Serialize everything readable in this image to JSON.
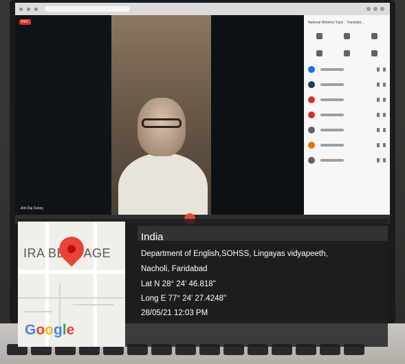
{
  "meet": {
    "rec_badge": "REC",
    "panel_title": "National Webinar Topic - Translatio...",
    "speaker_name": "Anil Raj Dubey",
    "participants": [
      {
        "avatar_color": "#1a73e8"
      },
      {
        "avatar_color": "#1f3b5c"
      },
      {
        "avatar_color": "#d93025"
      },
      {
        "avatar_color": "#d93025"
      },
      {
        "avatar_color": "#5f6368"
      },
      {
        "avatar_color": "#e37400"
      },
      {
        "avatar_color": "#5f6368"
      }
    ]
  },
  "geo_stamp": {
    "map_label": "IRA BE     AGE",
    "map_brand": [
      "G",
      "o",
      "o",
      "g",
      "l",
      "e"
    ],
    "country": "India",
    "address_line1": "Department of English,SOHSS, Lingayas vidyapeeth,",
    "address_line2": "Nacholi, Faridabad",
    "latitude": "Lat N 28° 24' 46.818\"",
    "longitude": "Long E 77° 24' 27.4248\"",
    "datetime": "28/05/21 12:03 PM"
  },
  "colors": {
    "pin": "#ea4335",
    "overlay": "#1e1e20",
    "end_call": "#e8452c"
  }
}
